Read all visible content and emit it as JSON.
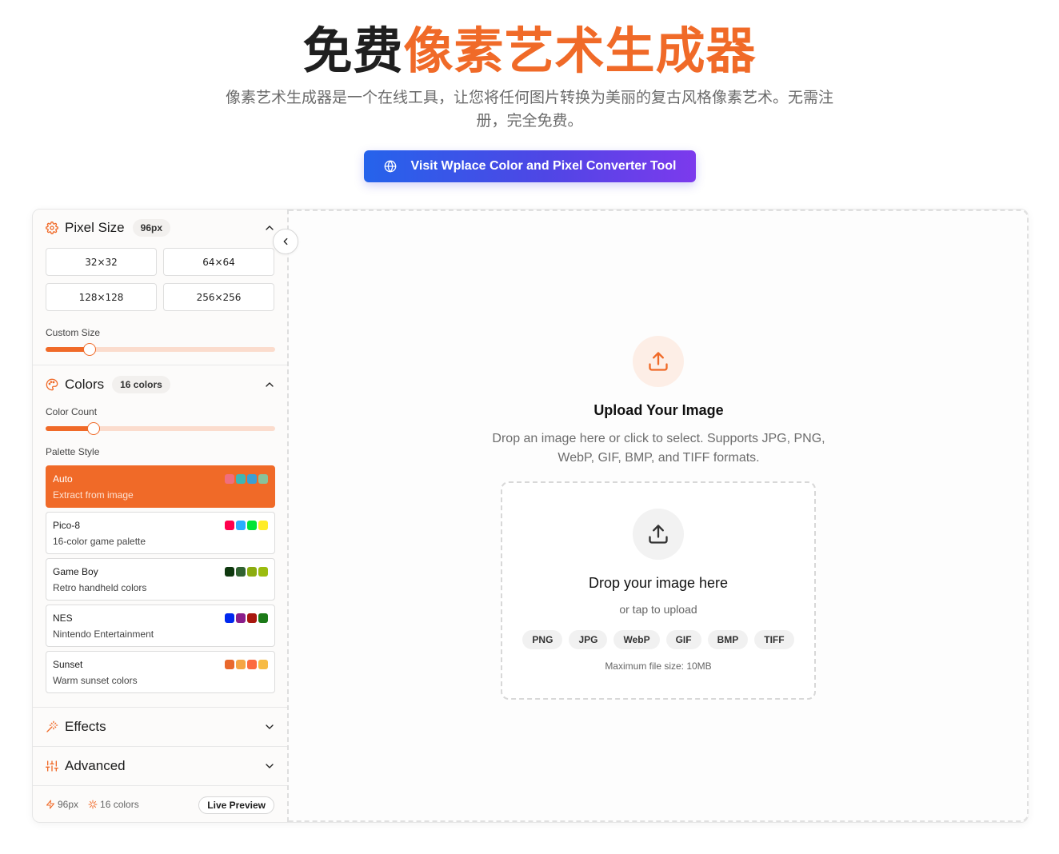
{
  "hero": {
    "title_plain": "免费",
    "title_accent": "像素艺术生成器",
    "subtitle": "像素艺术生成器是一个在线工具，让您将任何图片转换为美丽的复古风格像素艺术。无需注册，完全免费。",
    "cta_label": "Visit Wplace Color and Pixel Converter Tool",
    "cta_icon": "globe-icon"
  },
  "sidebar": {
    "pixel_size": {
      "title": "Pixel Size",
      "badge": "96px",
      "presets": [
        "32×32",
        "64×64",
        "128×128",
        "256×256"
      ],
      "custom_label": "Custom Size",
      "custom_value_fraction": 0.19
    },
    "colors": {
      "title": "Colors",
      "badge": "16 colors",
      "count_label": "Color Count",
      "count_value_fraction": 0.21,
      "palette_label": "Palette Style",
      "palettes": [
        {
          "name": "Auto",
          "desc": "Extract from image",
          "active": true,
          "swatches": [
            "#f06e7e",
            "#3fb6b4",
            "#3b9fd4",
            "#89c29a"
          ]
        },
        {
          "name": "Pico-8",
          "desc": "16-color game palette",
          "active": false,
          "swatches": [
            "#ff004d",
            "#29adff",
            "#00e436",
            "#ffec27"
          ]
        },
        {
          "name": "Game Boy",
          "desc": "Retro handheld colors",
          "active": false,
          "swatches": [
            "#0f380f",
            "#306230",
            "#8bac0f",
            "#9bbc0f"
          ]
        },
        {
          "name": "NES",
          "desc": "Nintendo Entertainment",
          "active": false,
          "swatches": [
            "#0028ef",
            "#8a1d8a",
            "#a8180f",
            "#1c7a18"
          ]
        },
        {
          "name": "Sunset",
          "desc": "Warm sunset colors",
          "active": false,
          "swatches": [
            "#e9682c",
            "#f5a544",
            "#fc6b3f",
            "#f7bb45"
          ]
        }
      ]
    },
    "effects": {
      "title": "Effects"
    },
    "advanced": {
      "title": "Advanced"
    },
    "footer": {
      "size": "96px",
      "colors": "16 colors",
      "live_preview": "Live Preview"
    }
  },
  "main": {
    "upload_title": "Upload Your Image",
    "upload_desc": "Drop an image here or click to select. Supports JPG, PNG, WebP, GIF, BMP, and TIFF formats.",
    "drop_title": "Drop your image here",
    "drop_sub": "or tap to upload",
    "formats": [
      "PNG",
      "JPG",
      "WebP",
      "GIF",
      "BMP",
      "TIFF"
    ],
    "max_size": "Maximum file size: 10MB"
  },
  "colors": {
    "accent": "#f06a28",
    "accent_light": "#fbdccd",
    "cta_start": "#2563eb",
    "cta_end": "#7c3aed"
  }
}
